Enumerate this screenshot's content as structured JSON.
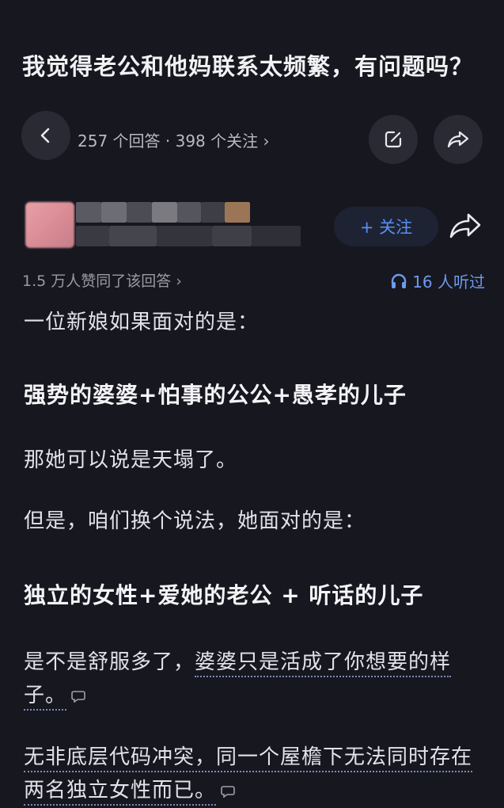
{
  "question": {
    "title": "我觉得老公和他妈联系太频繁，有问题吗？",
    "stats": "257 个回答 · 398 个关注 ›"
  },
  "icons": {
    "back": "chevron-left-icon",
    "edit": "edit-icon",
    "share": "share-icon",
    "headphones": "headphones-icon",
    "comment": "comment-icon"
  },
  "author": {
    "follow_label": "+ 关注"
  },
  "answer_meta": {
    "likes_text": "1.5 万人赞同了该回答 ›",
    "listens_text": "16 人听过"
  },
  "answer": {
    "p1": "一位新娘如果面对的是：",
    "p2": "强势的婆婆+怕事的公公+愚孝的儿子",
    "p3": "那她可以说是天塌了。",
    "p4": "但是，咱们换个说法，她面对的是：",
    "p5": "独立的女性+爱她的老公 + 听话的儿子",
    "p6_a": "是不是舒服多了，",
    "p6_b": "婆婆只是活成了你想要的样子。",
    "p7_a": "无非底层代码冲突，同一个屋檐下无法同时存在两名独立女性而已。"
  },
  "colors": {
    "background": "#17171f",
    "accent": "#5a8ff2"
  }
}
